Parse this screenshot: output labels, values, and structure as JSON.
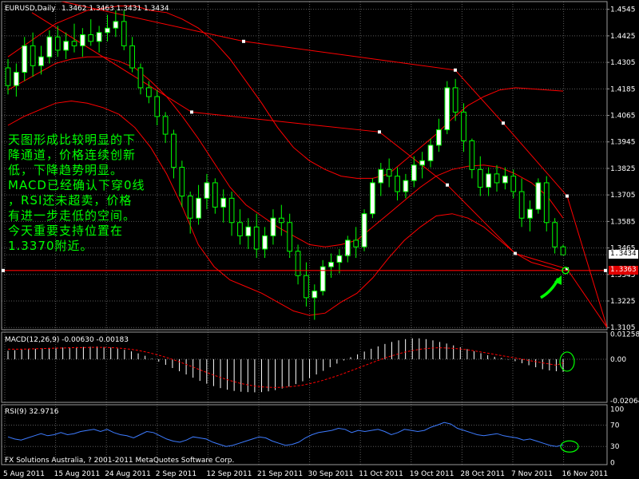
{
  "chart_data": [
    {
      "type": "candlestick",
      "title": "EURUSD,Daily",
      "ohlc_header": "1.3462 1.3463 1.3431 1.3434",
      "current_price_label": "1.3434",
      "support_line_label": "1.3363",
      "support_value": 1.3363,
      "y_tick_labels": [
        "1.4545",
        "1.4425",
        "1.4305",
        "1.4185",
        "1.4065",
        "1.3945",
        "1.3825",
        "1.3705",
        "1.3585",
        "1.3465",
        "1.3345",
        "1.3225",
        "1.3105"
      ],
      "y_ticks": [
        1.4545,
        1.4425,
        1.4305,
        1.4185,
        1.4065,
        1.3945,
        1.3825,
        1.3705,
        1.3585,
        1.3465,
        1.3345,
        1.3225,
        1.3105
      ],
      "ylim": [
        1.3095,
        1.458
      ],
      "x_tick_labels": [
        "5 Aug 2011",
        "15 Aug 2011",
        "24 Aug 2011",
        "2 Sep 2011",
        "12 Sep 2011",
        "21 Sep 2011",
        "30 Sep 2011",
        "11 Oct 2011",
        "19 Oct 2011",
        "28 Oct 2011",
        "7 Nov 2011",
        "16 Nov 2011"
      ],
      "grid": true,
      "candles": [
        [
          1.428,
          1.432,
          1.416,
          1.42
        ],
        [
          1.42,
          1.43,
          1.415,
          1.426
        ],
        [
          1.426,
          1.442,
          1.422,
          1.438
        ],
        [
          1.438,
          1.444,
          1.424,
          1.429
        ],
        [
          1.429,
          1.438,
          1.425,
          1.433
        ],
        [
          1.433,
          1.445,
          1.43,
          1.442
        ],
        [
          1.442,
          1.447,
          1.433,
          1.436
        ],
        [
          1.436,
          1.444,
          1.432,
          1.44
        ],
        [
          1.44,
          1.448,
          1.435,
          1.438
        ],
        [
          1.438,
          1.446,
          1.433,
          1.443
        ],
        [
          1.443,
          1.45,
          1.438,
          1.44
        ],
        [
          1.44,
          1.447,
          1.435,
          1.444
        ],
        [
          1.444,
          1.452,
          1.44,
          1.446
        ],
        [
          1.446,
          1.454,
          1.442,
          1.449
        ],
        [
          1.449,
          1.454,
          1.436,
          1.438
        ],
        [
          1.438,
          1.442,
          1.426,
          1.428
        ],
        [
          1.428,
          1.43,
          1.416,
          1.419
        ],
        [
          1.419,
          1.422,
          1.412,
          1.415
        ],
        [
          1.415,
          1.418,
          1.402,
          1.406
        ],
        [
          1.406,
          1.408,
          1.394,
          1.398
        ],
        [
          1.398,
          1.4,
          1.378,
          1.383
        ],
        [
          1.383,
          1.386,
          1.365,
          1.37
        ],
        [
          1.37,
          1.372,
          1.353,
          1.36
        ],
        [
          1.36,
          1.375,
          1.357,
          1.369
        ],
        [
          1.369,
          1.38,
          1.364,
          1.376
        ],
        [
          1.376,
          1.378,
          1.362,
          1.365
        ],
        [
          1.365,
          1.373,
          1.358,
          1.369
        ],
        [
          1.369,
          1.372,
          1.352,
          1.358
        ],
        [
          1.358,
          1.364,
          1.348,
          1.352
        ],
        [
          1.352,
          1.36,
          1.346,
          1.356
        ],
        [
          1.356,
          1.362,
          1.342,
          1.346
        ],
        [
          1.346,
          1.356,
          1.342,
          1.352
        ],
        [
          1.352,
          1.364,
          1.348,
          1.36
        ],
        [
          1.36,
          1.366,
          1.352,
          1.358
        ],
        [
          1.358,
          1.362,
          1.342,
          1.345
        ],
        [
          1.345,
          1.348,
          1.33,
          1.334
        ],
        [
          1.334,
          1.34,
          1.32,
          1.324
        ],
        [
          1.324,
          1.33,
          1.314,
          1.327
        ],
        [
          1.327,
          1.341,
          1.325,
          1.338
        ],
        [
          1.338,
          1.344,
          1.333,
          1.34
        ],
        [
          1.34,
          1.346,
          1.335,
          1.343
        ],
        [
          1.343,
          1.352,
          1.34,
          1.35
        ],
        [
          1.35,
          1.356,
          1.342,
          1.347
        ],
        [
          1.347,
          1.364,
          1.345,
          1.362
        ],
        [
          1.362,
          1.378,
          1.36,
          1.376
        ],
        [
          1.376,
          1.385,
          1.37,
          1.382
        ],
        [
          1.382,
          1.387,
          1.374,
          1.379
        ],
        [
          1.379,
          1.383,
          1.368,
          1.372
        ],
        [
          1.372,
          1.38,
          1.369,
          1.377
        ],
        [
          1.377,
          1.388,
          1.374,
          1.384
        ],
        [
          1.384,
          1.39,
          1.378,
          1.386
        ],
        [
          1.386,
          1.396,
          1.383,
          1.393
        ],
        [
          1.393,
          1.405,
          1.39,
          1.4
        ],
        [
          1.4,
          1.422,
          1.398,
          1.419
        ],
        [
          1.419,
          1.423,
          1.404,
          1.408
        ],
        [
          1.408,
          1.412,
          1.39,
          1.395
        ],
        [
          1.395,
          1.396,
          1.378,
          1.382
        ],
        [
          1.382,
          1.388,
          1.37,
          1.374
        ],
        [
          1.374,
          1.383,
          1.37,
          1.38
        ],
        [
          1.38,
          1.384,
          1.372,
          1.376
        ],
        [
          1.376,
          1.383,
          1.373,
          1.379
        ],
        [
          1.379,
          1.382,
          1.369,
          1.372
        ],
        [
          1.372,
          1.378,
          1.356,
          1.36
        ],
        [
          1.36,
          1.368,
          1.354,
          1.364
        ],
        [
          1.364,
          1.378,
          1.362,
          1.376
        ],
        [
          1.376,
          1.379,
          1.354,
          1.358
        ],
        [
          1.358,
          1.36,
          1.344,
          1.347
        ],
        [
          1.347,
          1.348,
          1.3431,
          1.3434
        ]
      ],
      "bands_upper": [
        1.433,
        1.438,
        1.443,
        1.448,
        1.451,
        1.454,
        1.455,
        1.456,
        1.456,
        1.454,
        1.453,
        1.45,
        1.446,
        1.44,
        1.432,
        1.422,
        1.412,
        1.401,
        1.392,
        1.386,
        1.382,
        1.379,
        1.378,
        1.378,
        1.38,
        1.386,
        1.392,
        1.398,
        1.405,
        1.411,
        1.415,
        1.418,
        1.419,
        1.4185,
        1.418,
        1.4175
      ],
      "bands_middle": [
        1.418,
        1.422,
        1.426,
        1.43,
        1.432,
        1.433,
        1.433,
        1.431,
        1.428,
        1.422,
        1.415,
        1.406,
        1.396,
        1.385,
        1.374,
        1.366,
        1.361,
        1.356,
        1.352,
        1.348,
        1.347,
        1.348,
        1.35,
        1.356,
        1.362,
        1.368,
        1.374,
        1.379,
        1.382,
        1.3835,
        1.384,
        1.383,
        1.38,
        1.376,
        1.37,
        1.36
      ],
      "bands_lower": [
        1.402,
        1.406,
        1.409,
        1.412,
        1.413,
        1.412,
        1.41,
        1.407,
        1.401,
        1.392,
        1.38,
        1.365,
        1.348,
        1.338,
        1.332,
        1.329,
        1.326,
        1.322,
        1.318,
        1.316,
        1.317,
        1.322,
        1.326,
        1.333,
        1.342,
        1.35,
        1.356,
        1.361,
        1.362,
        1.36,
        1.356,
        1.35,
        1.344,
        1.34,
        1.338,
        1.336
      ],
      "channel_upper": [
        [
          40,
          1.461
        ],
        [
          305,
          1.44
        ],
        [
          570,
          1.427
        ],
        [
          630,
          1.403
        ],
        [
          710,
          1.37
        ],
        [
          760,
          1.3105
        ]
      ],
      "channel_lower": [
        [
          40,
          1.453
        ],
        [
          240,
          1.408
        ],
        [
          475,
          1.399
        ],
        [
          560,
          1.375
        ],
        [
          645,
          1.344
        ],
        [
          710,
          1.337
        ],
        [
          760,
          1.3105
        ]
      ]
    },
    {
      "type": "histogram",
      "title": "MACD(12,26,9) -0.00630 -0.00183",
      "y_tick_labels": [
        "0.01258",
        "0.00",
        "-0.02064"
      ],
      "y_ticks": [
        0.01258,
        0.0,
        -0.02064
      ],
      "ylim": [
        -0.0215,
        0.0135
      ],
      "macd": [
        0.0042,
        0.0045,
        0.0048,
        0.005,
        0.0052,
        0.0054,
        0.0056,
        0.0057,
        0.0058,
        0.0059,
        0.006,
        0.0061,
        0.0062,
        0.0063,
        0.0061,
        0.0058,
        0.0053,
        0.0047,
        0.0039,
        0.0029,
        0.0017,
        0.0003,
        -0.0012,
        -0.0028,
        -0.0044,
        -0.006,
        -0.0076,
        -0.0092,
        -0.0108,
        -0.0122,
        -0.0134,
        -0.0144,
        -0.0152,
        -0.0158,
        -0.0162,
        -0.0164,
        -0.0165,
        -0.0164,
        -0.016,
        -0.0154,
        -0.0146,
        -0.0136,
        -0.0124,
        -0.011,
        -0.0094,
        -0.0076,
        -0.0058,
        -0.004,
        -0.0022,
        -0.0006,
        0.001,
        0.0024,
        0.0038,
        0.0052,
        0.0064,
        0.0076,
        0.0086,
        0.0094,
        0.01,
        0.0104,
        0.0104,
        0.01,
        0.0094,
        0.0086,
        0.0078,
        0.0069,
        0.006,
        0.005,
        0.004,
        0.003,
        0.002,
        0.0012,
        0.0006,
        -0.0002,
        -0.001,
        -0.002,
        -0.003,
        -0.004,
        -0.005,
        -0.0056,
        -0.006,
        -0.0063
      ],
      "signal": [
        0.005,
        0.005,
        0.005,
        0.0051,
        0.0052,
        0.0053,
        0.0054,
        0.0055,
        0.0056,
        0.0057,
        0.0058,
        0.0058,
        0.0059,
        0.0059,
        0.0059,
        0.0058,
        0.0056,
        0.0053,
        0.0049,
        0.0044,
        0.0037,
        0.0029,
        0.002,
        0.001,
        -0.0001,
        -0.0013,
        -0.0026,
        -0.0039,
        -0.0053,
        -0.0066,
        -0.0079,
        -0.0091,
        -0.0102,
        -0.0112,
        -0.0121,
        -0.0128,
        -0.0134,
        -0.0138,
        -0.014,
        -0.0141,
        -0.014,
        -0.0138,
        -0.0134,
        -0.0129,
        -0.0122,
        -0.0114,
        -0.0105,
        -0.0094,
        -0.0083,
        -0.0071,
        -0.0058,
        -0.0045,
        -0.0032,
        -0.0019,
        -0.0006,
        0.0006,
        0.0017,
        0.0027,
        0.0036,
        0.0043,
        0.0049,
        0.0053,
        0.0056,
        0.0057,
        0.0056,
        0.0054,
        0.0051,
        0.0047,
        0.0042,
        0.0036,
        0.003,
        0.0024,
        0.0018,
        0.0012,
        0.0006,
        0.0,
        -0.0006,
        -0.0012,
        -0.0018,
        -0.0024,
        -0.003,
        -0.0018
      ]
    },
    {
      "type": "line",
      "title": "RSI(9) 32.9716",
      "y_tick_labels": [
        "100",
        "70",
        "30",
        "0"
      ],
      "y_ticks": [
        100,
        70,
        30,
        0
      ],
      "ylim": [
        -4,
        108
      ],
      "values": [
        48,
        44,
        42,
        46,
        50,
        54,
        50,
        52,
        56,
        52,
        54,
        58,
        60,
        62,
        58,
        62,
        56,
        52,
        50,
        46,
        52,
        58,
        56,
        50,
        44,
        40,
        38,
        42,
        48,
        46,
        44,
        38,
        34,
        30,
        32,
        36,
        40,
        44,
        48,
        46,
        40,
        36,
        32,
        34,
        38,
        46,
        52,
        56,
        58,
        60,
        64,
        62,
        56,
        60,
        58,
        60,
        62,
        58,
        52,
        56,
        62,
        60,
        58,
        60,
        66,
        70,
        75,
        72,
        64,
        60,
        56,
        52,
        50,
        52,
        54,
        50,
        48,
        46,
        42,
        44,
        40,
        36,
        32,
        30,
        33
      ]
    }
  ],
  "annotation": {
    "lines": [
      "天图形成比较明显的下",
      "降通道，价格连续创新",
      "低，下降趋势明显。",
      "MACD已经确认下穿0线",
      "，RSI还未超卖，价格",
      "有进一步走低的空间。",
      "今天重要支持位置在",
      "1.3370附近。"
    ]
  },
  "footer": {
    "copyright": "FX Solutions Australia, ? 2001-2011 MetaQuotes Software Corp."
  },
  "colors": {
    "bullish_candle": "#ffffff",
    "bearish_candle": "#000000",
    "wick": "#00ff00",
    "bands": "#ff0000",
    "channel": "#ff0000",
    "support_line": "#ff0000",
    "macd_histogram": "#ffffff",
    "macd_signal": "#ff0000",
    "rsi_line": "#3d7bff",
    "annotation_text": "#00ff00",
    "marker": "#00ff00"
  }
}
